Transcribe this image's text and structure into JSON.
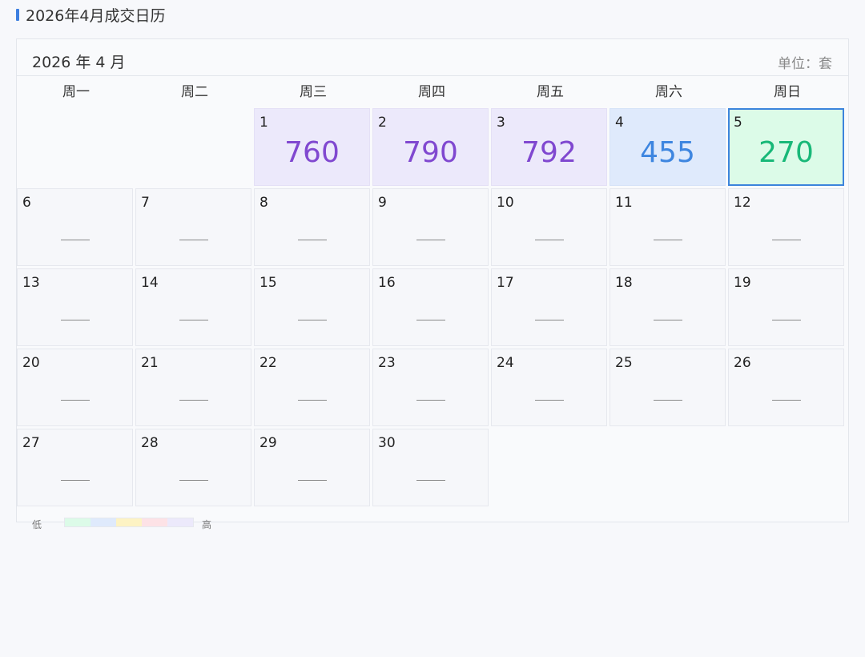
{
  "page": {
    "title": "2026年4月成交日历"
  },
  "calendar": {
    "month_label": "2026 年 4 月",
    "unit_label": "单位：套",
    "weekdays": [
      "周一",
      "周二",
      "周三",
      "周四",
      "周五",
      "周六",
      "周日"
    ],
    "empty_marker": "—",
    "days": [
      {
        "day": "1",
        "value": "760",
        "level": "purple"
      },
      {
        "day": "2",
        "value": "790",
        "level": "purple"
      },
      {
        "day": "3",
        "value": "792",
        "level": "purple"
      },
      {
        "day": "4",
        "value": "455",
        "level": "blue"
      },
      {
        "day": "5",
        "value": "270",
        "level": "green",
        "selected": true
      },
      {
        "day": "6"
      },
      {
        "day": "7"
      },
      {
        "day": "8"
      },
      {
        "day": "9"
      },
      {
        "day": "10"
      },
      {
        "day": "11"
      },
      {
        "day": "12"
      },
      {
        "day": "13"
      },
      {
        "day": "14"
      },
      {
        "day": "15"
      },
      {
        "day": "16"
      },
      {
        "day": "17"
      },
      {
        "day": "18"
      },
      {
        "day": "19"
      },
      {
        "day": "20"
      },
      {
        "day": "21"
      },
      {
        "day": "22"
      },
      {
        "day": "23"
      },
      {
        "day": "24"
      },
      {
        "day": "25"
      },
      {
        "day": "26"
      },
      {
        "day": "27"
      },
      {
        "day": "28"
      },
      {
        "day": "29"
      },
      {
        "day": "30"
      }
    ],
    "first_weekday_index": 2
  },
  "legend": {
    "low_label": "低",
    "high_label": "高",
    "colors": [
      "#dcfbe8",
      "#dfeafc",
      "#fdf3c4",
      "#fde2e6",
      "#ece9fb"
    ]
  }
}
